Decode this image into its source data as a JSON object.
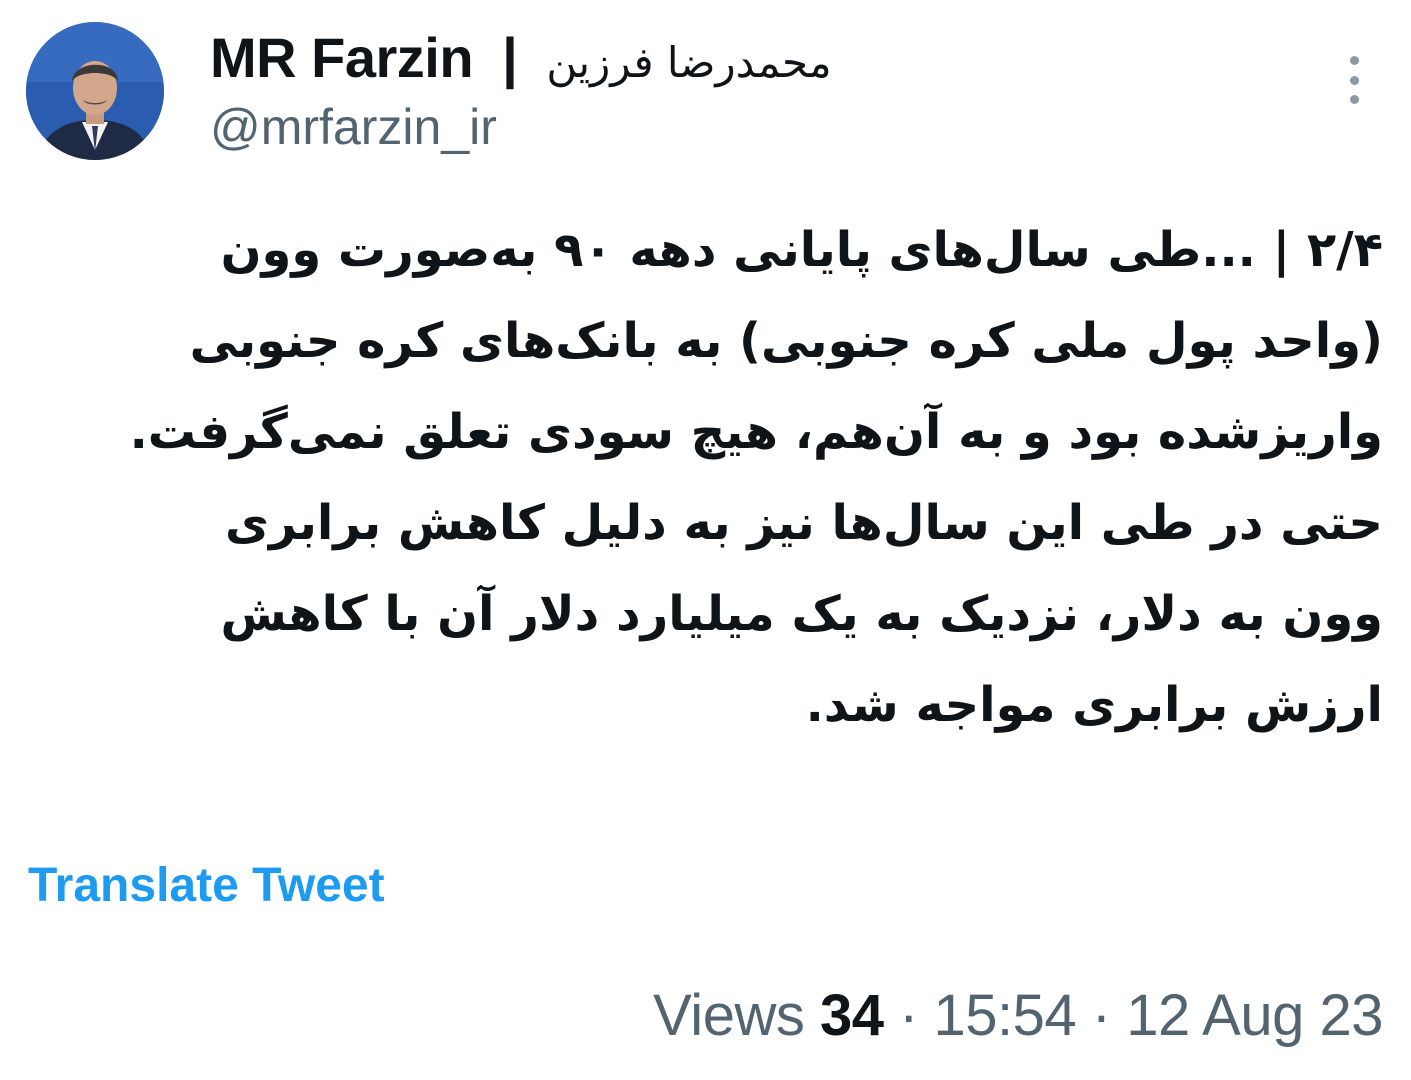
{
  "author": {
    "display_name_latin": "MR Farzin",
    "separator": "|",
    "display_name_persian": "محمدرضا فرزین",
    "handle": "@mrfarzin_ir"
  },
  "tweet": {
    "lines": [
      "۲/۴ | ...طی سال‌های پایانی دهه ۹۰ به‌صورت وون",
      "(واحد پول ملی کره جنوبی) به بانک‌های کره جنوبی",
      "واریزشده بود و به آن‌هم، هیچ سودی تعلق نمی‌گرفت.",
      "حتی در طی این سال‌ها نیز به دلیل کاهش برابری",
      "وون به دلار، نزدیک به یک میلیارد دلار آن با کاهش",
      "ارزش برابری مواجه شد."
    ]
  },
  "actions": {
    "translate_label": "Translate Tweet"
  },
  "meta": {
    "views_label": "Views",
    "views_count": "34",
    "separator_1": " · ",
    "time": "15:54",
    "separator_2": " · ",
    "date": "12 Aug 23"
  },
  "icons": {
    "more": "more-vertical-icon"
  },
  "colors": {
    "link": "#1d9bf0",
    "secondary_text": "#536471",
    "primary_text": "#0f1419"
  }
}
